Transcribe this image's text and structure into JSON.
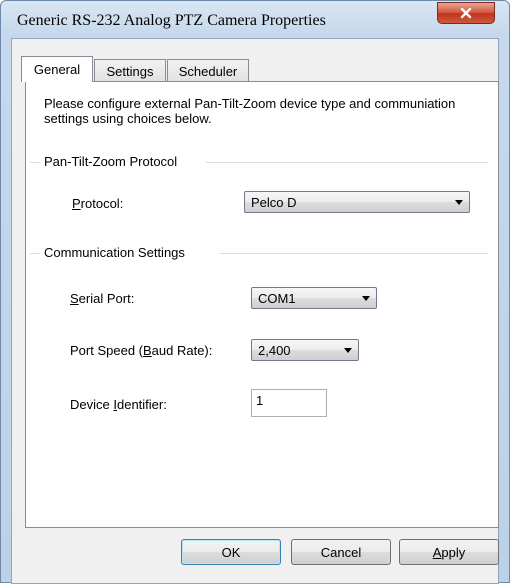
{
  "window": {
    "title": "Generic RS-232 Analog PTZ Camera Properties",
    "close_glyph": "x"
  },
  "tabs": [
    {
      "label": "General",
      "active": true
    },
    {
      "label": "Settings",
      "active": false
    },
    {
      "label": "Scheduler",
      "active": false
    }
  ],
  "general": {
    "intro": "Please configure external Pan-Tilt-Zoom device type and communiation settings using choices below.",
    "ptz_group": {
      "title": "Pan-Tilt-Zoom Protocol",
      "protocol_label_access": "P",
      "protocol_label_rest": "rotocol:",
      "protocol_value": "Pelco D"
    },
    "comm_group": {
      "title": "Communication Settings",
      "serial_port_label_access": "S",
      "serial_port_label_rest": "erial Port:",
      "serial_port_value": "COM1",
      "speed_label_pre": "Port Speed (",
      "speed_label_access": "B",
      "speed_label_post": "aud Rate):",
      "speed_value": "2,400",
      "device_label_pre": "Device ",
      "device_label_access": "I",
      "device_label_post": "dentifier:",
      "device_value": "1"
    }
  },
  "buttons": {
    "ok": "OK",
    "cancel": "Cancel",
    "apply_access": "A",
    "apply_rest": "pply"
  },
  "colors": {
    "title_bar": "#c6d8ec",
    "close_button": "#c1331b",
    "panel_background": "#f0f0f0",
    "default_button_border": "#3c7fb1"
  }
}
